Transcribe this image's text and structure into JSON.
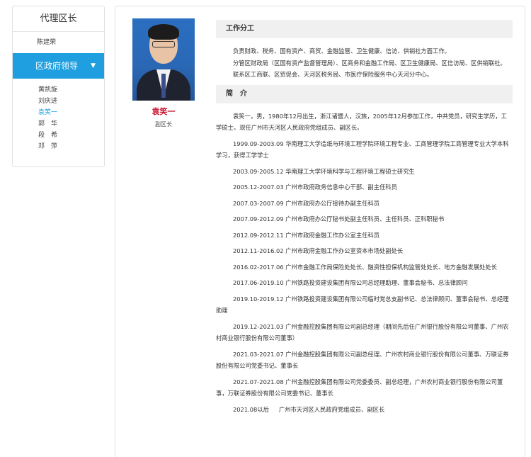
{
  "sidebar": {
    "title": "代理区长",
    "top_item": "陈建荣",
    "active_section": "区政府领导",
    "items": [
      "黄凯旋",
      "刘庆进",
      "袁笑一",
      "郭　华",
      "段　希",
      "邓　萍"
    ],
    "current_index": 2
  },
  "profile": {
    "name": "袁笑一",
    "title": "副区长"
  },
  "duties": {
    "heading": "工作分工",
    "paragraphs": [
      "负责财政、税务、国有资产、商贸、金融监管、卫生健康、信访、供销社方面工作。",
      "分管区财政局（区国有资产监督管理局）、区商务和金融工作局、区卫生健康局、区信访局、区供销联社。",
      "联系区工商联、区贸促会、天河区税务局、市医疗保险服务中心天河分中心。"
    ]
  },
  "intro": {
    "heading": "简　介",
    "summary": "袁笑一，男，1980年12月出生，浙江诸暨人，汉族，2005年12月参加工作，中共党员，研究生学历，工学硕士。现任广州市天河区人民政府党组成员、副区长。",
    "entries": [
      "1999.09-2003.09 华南理工大学造纸与环境工程学院环境工程专业、工商管理学院工商管理专业大学本科学习，获得工学学士",
      "2003.09-2005.12 华南理工大学环境科学与工程环境工程硕士研究生",
      "2005.12-2007.03 广州市政府政务信息中心干部、副主任科员",
      "2007.03-2007.09 广州市政府办公厅接待办副主任科员",
      "2007.09-2012.09 广州市政府办公厅秘书处副主任科员、主任科员、正科职秘书",
      "2012.09-2012.11 广州市政府金融工作办公室主任科员",
      "2012.11-2016.02 广州市政府金融工作办公室资本市场处副处长",
      "2016.02-2017.06 广州市金融工作局保险处处长、融资性担保机构监管处处长、地方金融发展处处长",
      "2017.06-2019.10 广州铁路投资建设集团有限公司总经理助理、董事会秘书、总法律顾问",
      "2019.10-2019.12 广州铁路投资建设集团有限公司临时党总支副书记、总法律顾问、董事会秘书、总经理助理",
      "2019.12-2021.03 广州金融控股集团有限公司副总经理（期间先后任广州银行股份有限公司董事、广州农村商业银行股份有限公司董事）",
      "2021.03-2021.07 广州金融控股集团有限公司副总经理、广州农村商业银行股份有限公司董事、万联证券股份有限公司党委书记、董事长",
      "2021.07-2021.08 广州金融控股集团有限公司党委委员、副总经理，广州农村商业银行股份有限公司董事，万联证券股份有限公司党委书记、董事长"
    ],
    "last_date": "2021.08以后",
    "last_text": "广州市天河区人民政府党组成员、副区长"
  },
  "colors": {
    "accent": "#1f9fdf",
    "name_red": "#c8102e"
  }
}
